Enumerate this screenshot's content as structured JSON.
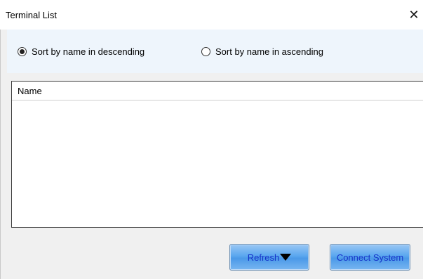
{
  "window": {
    "title": "Terminal List",
    "close_symbol": "✕"
  },
  "sort": {
    "options": [
      {
        "label": "Sort by name in descending",
        "selected": true
      },
      {
        "label": "Sort by name in  ascending",
        "selected": false
      }
    ]
  },
  "list": {
    "columns": [
      "Name"
    ],
    "rows": []
  },
  "buttons": {
    "refresh_label": "Refresh",
    "refresh_icon": "dropdown-triangle-icon",
    "connect_label": "Connect System"
  },
  "colors": {
    "button_text": "#1533c9",
    "button_fill": "#5aa6ef",
    "sort_panel_bg": "#eef5fc"
  }
}
